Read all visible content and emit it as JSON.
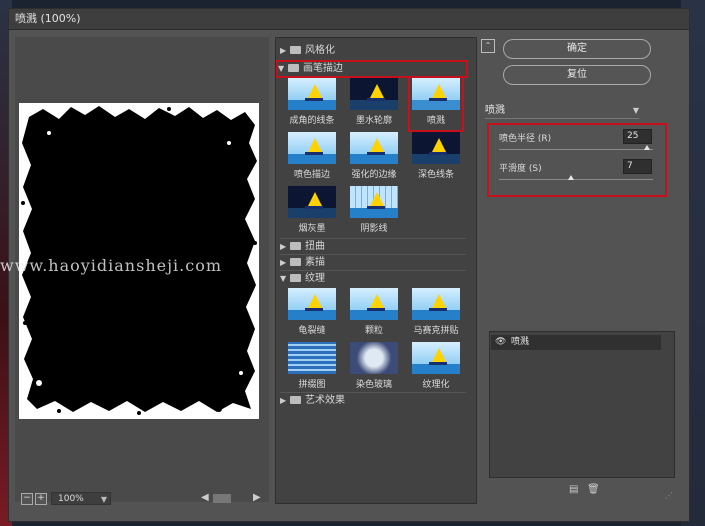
{
  "dialog": {
    "title": "喷溅 (100%)"
  },
  "preview": {
    "zoom": "100%"
  },
  "gallery": {
    "categories": {
      "stylize": "风格化",
      "brush": "画笔描边",
      "distort": "扭曲",
      "sketch": "素描",
      "texture": "纹理",
      "artistic": "艺术效果"
    },
    "brush_filters": [
      "成角的线条",
      "墨水轮廓",
      "喷溅",
      "喷色描边",
      "强化的边缘",
      "深色线条",
      "烟灰墨",
      "阴影线"
    ],
    "texture_filters": [
      "龟裂缝",
      "颗粒",
      "马赛克拼贴",
      "拼缀图",
      "染色玻璃",
      "纹理化"
    ],
    "selected_filter": "喷溅"
  },
  "buttons": {
    "ok": "确定",
    "reset": "复位"
  },
  "filter_select": {
    "value": "喷溅"
  },
  "params": {
    "spray_radius": {
      "label": "喷色半径 (R)",
      "value": "25",
      "fraction": 0.96
    },
    "smoothness": {
      "label": "平滑度 (S)",
      "value": "7",
      "fraction": 0.47
    }
  },
  "layers": {
    "items": [
      "喷溅"
    ]
  },
  "watermark": "www.haoyidiansheji.com",
  "colors": {
    "accent_highlight": "#c8101b",
    "dialog_bg": "#535353"
  }
}
